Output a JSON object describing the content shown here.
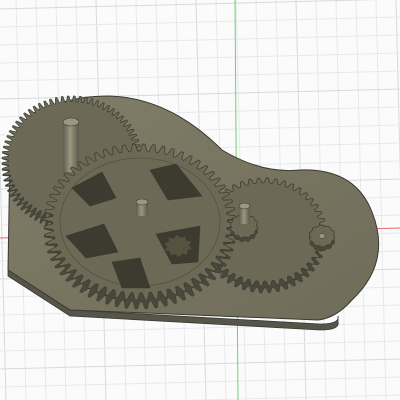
{
  "viewport": {
    "background": "#fbfbfb",
    "grid_minor_color": "#e6e9ec",
    "grid_major_color": "#d6dadd",
    "axis_x_color": "#e86a6a",
    "axis_y_color": "#6fd06f"
  },
  "model": {
    "body_color": "#76735f",
    "edge_color": "#3a3a32",
    "gear_color": "#6c6a56",
    "tooth_color": "#4a483b",
    "side_color": "#57554a",
    "shaft_color": "#85836f",
    "highlight_color": "#9a987f"
  },
  "gears": [
    {
      "name": "gear-back-large",
      "teeth": 72
    },
    {
      "name": "gear-front-large",
      "teeth": 60
    },
    {
      "name": "gear-middle",
      "teeth": 44
    },
    {
      "name": "gear-pinion-small",
      "teeth": 12
    },
    {
      "name": "gear-pinion-tiny",
      "teeth": 10
    }
  ]
}
